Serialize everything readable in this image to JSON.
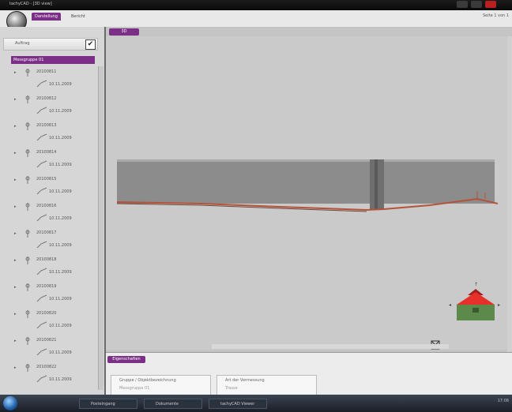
{
  "window": {
    "title": "tachyCAD - [3D view]"
  },
  "menu": {
    "tabs": [
      "Darstellung",
      "Bericht"
    ],
    "context": "Seite 1 von 1"
  },
  "sidebar": {
    "header_label": "Auftrag",
    "selected_group": "Messgruppe 01",
    "items": [
      {
        "label": "20100811",
        "date": "10.11.2009"
      },
      {
        "label": "20100812",
        "date": "10.11.2009"
      },
      {
        "label": "20100813",
        "date": "10.11.2009"
      },
      {
        "label": "20100814",
        "date": "10.11.2009"
      },
      {
        "label": "20100815",
        "date": "10.11.2009"
      },
      {
        "label": "20100816",
        "date": "10.11.2009"
      },
      {
        "label": "20100817",
        "date": "10.11.2009"
      },
      {
        "label": "20100818",
        "date": "10.11.2009"
      },
      {
        "label": "20100819",
        "date": "10.11.2009"
      },
      {
        "label": "20100820",
        "date": "10.11.2009"
      },
      {
        "label": "20100821",
        "date": "10.11.2009"
      },
      {
        "label": "20100822",
        "date": "10.11.2009"
      }
    ]
  },
  "viewport": {
    "tab_label": "3D"
  },
  "bottom": {
    "tab_label": "Eigenschaften",
    "fields": [
      {
        "label": "Gruppe / Objektbezeichnung",
        "value": "Messgruppe 01"
      },
      {
        "label": "Art der Vermessung",
        "value": "Trasse"
      }
    ]
  },
  "taskbar": {
    "buttons": [
      "Posteingang",
      "Dokumente",
      "tachyCAD Viewer"
    ],
    "tray": "17:08"
  },
  "colors": {
    "accent": "#7b2f86",
    "trace": "#b5533a",
    "cube_top": "#e8302b",
    "cube_side": "#5c8a4a"
  }
}
